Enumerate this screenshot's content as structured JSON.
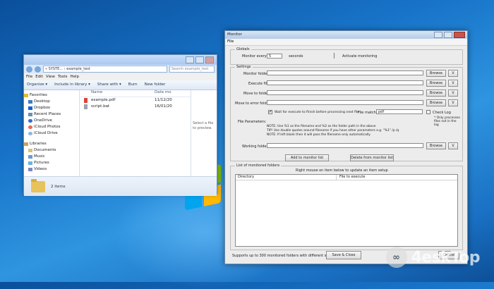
{
  "explorer": {
    "address_path": "« SYSTE... › example_test",
    "search_placeholder": "Search example_test",
    "menu": [
      "File",
      "Edit",
      "View",
      "Tools",
      "Help"
    ],
    "toolbar": [
      "Organize ▾",
      "Include in library ▾",
      "Share with ▾",
      "Burn",
      "New folder"
    ],
    "nav": {
      "favorites_header": "Favorites",
      "favorites": [
        "Desktop",
        "Dropbox",
        "Recent Places",
        "OneDrive",
        "iCloud Photos",
        "iCloud Drive"
      ],
      "libraries_header": "Libraries",
      "libraries": [
        "Documents",
        "Music",
        "Pictures",
        "Videos"
      ]
    },
    "columns": {
      "name": "Name",
      "date": "Date mo"
    },
    "files": [
      {
        "name": "example.pdf",
        "date": "11/12/20"
      },
      {
        "name": "script.bat",
        "date": "16/01/20"
      }
    ],
    "preview_text": "Select a file to preview.",
    "status": "2 items"
  },
  "monitor": {
    "title": "Monitor",
    "menu": "File",
    "globals": {
      "label": "Globals",
      "monitor_every": "Monitor every:",
      "seconds_value": "5",
      "seconds": "seconds",
      "activate": "Activate monitoring"
    },
    "settings": {
      "label": "Settings",
      "monitor_folder": "Monitor folder:",
      "execute_file": "Execute file:",
      "move_to_folder": "Move to folder:",
      "move_on_error": "Move to error folder:",
      "browse": "Browse",
      "v": "V",
      "wait_label": "Wait for execute to finish before processing next file",
      "file_match": "File match:",
      "file_match_value": "pdf",
      "check_log": "Check Log",
      "only_processes": "* Only processes files not in the log",
      "file_params": "File Parameters:",
      "note1": "NOTE: Use %1 as the filename and %2 as the folder path in the above",
      "note2": "TIP! Use double quotes around filename if you have other parameters e.g. \"%1\" /p /q",
      "note3": "NOTE: If left blank then it will pass the filename only automatically",
      "working_folder": "Working folder:"
    },
    "add_button": "Add to monitor list",
    "delete_button": "Delete from monitor list",
    "list": {
      "label": "List of monitored folders",
      "hint": "Right mouse on item below to update an item setup",
      "col_directory": "Directory",
      "col_file": "File to execute"
    },
    "footer": "Supports up to 300 monitored folders with different setups",
    "save_close": "Save & Close",
    "cancel": "Cancel"
  },
  "watermark": "4eskTop"
}
